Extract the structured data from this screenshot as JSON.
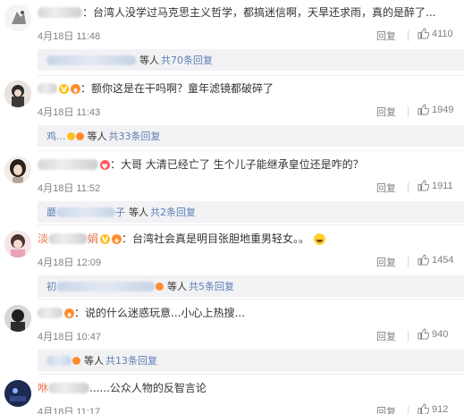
{
  "ui": {
    "reply_label": "回复",
    "people_suffix": "等人",
    "like_icon": "thumbs-up-icon"
  },
  "comments": [
    {
      "author_visible": "",
      "text": "：台湾人没学过马克思主义哲学，都搞迷信啊，天旱还求雨，真的是醉了...",
      "time": "4月18日 11:48",
      "likes": "4110",
      "sub": {
        "name_visible": "",
        "count_text": "共70条回复"
      }
    },
    {
      "author_visible": "",
      "text": "：额你这是在干吗啊？童年滤镜都破碎了",
      "time": "4月18日 11:43",
      "likes": "1949",
      "sub": {
        "name_visible": "鸡...",
        "count_text": "共33条回复"
      }
    },
    {
      "author_visible": "",
      "text": "：大哥 大清已经亡了 生个儿子能继承皇位还是咋的？",
      "time": "4月18日 11:52",
      "likes": "1911",
      "sub": {
        "name_visible": "蘑",
        "name_tail": "子",
        "count_text": "共2条回复"
      }
    },
    {
      "author_visible": "淡",
      "author_tail": "娟",
      "text": "：台湾社会真是明目张胆地重男轻女。。",
      "time": "4月18日 12:09",
      "likes": "1454",
      "sub": {
        "name_visible": "初",
        "count_text": "共5条回复"
      }
    },
    {
      "author_visible": "",
      "text": "：说的什么迷惑玩意...小心上热搜...",
      "time": "4月18日 10:47",
      "likes": "940",
      "sub": {
        "name_visible": "",
        "count_text": "共13条回复"
      }
    },
    {
      "author_visible": "咻",
      "text": "......公众人物的反智言论",
      "time": "4月18日 11:17",
      "likes": "912"
    }
  ]
}
